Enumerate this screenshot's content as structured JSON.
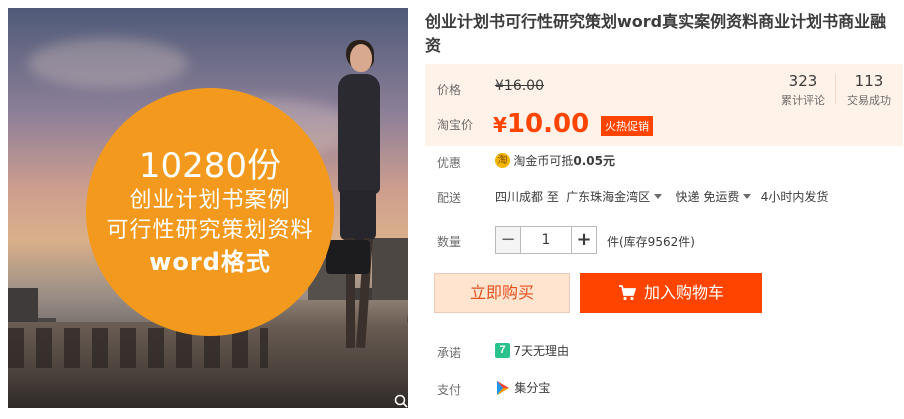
{
  "product": {
    "title": "创业计划书可行性研究策划word真实案例资料商业计划书商业融资",
    "image_banner": {
      "line1": "10280份",
      "line2": "创业计划书案例",
      "line3": "可行性研究策划资料",
      "line4": "word格式"
    }
  },
  "price": {
    "label": "价格",
    "original": "¥16.00",
    "taobao_label": "淘宝价",
    "currency_symbol": "¥",
    "current": "10.00",
    "promo_badge": "火热促销"
  },
  "stats": {
    "reviews_count": "323",
    "reviews_label": "累计评论",
    "sales_count": "113",
    "sales_label": "交易成功"
  },
  "discount": {
    "label": "优惠",
    "coin_glyph": "淘",
    "text": "淘金币可抵",
    "amount": "0.05元"
  },
  "delivery": {
    "label": "配送",
    "from": "四川成都 至",
    "to": "广东珠海金湾区",
    "method": "快递 免运费",
    "ship_time": "4小时内发货"
  },
  "quantity": {
    "label": "数量",
    "minus": "−",
    "value": "1",
    "plus": "+",
    "stock": "件(库存9562件)"
  },
  "buttons": {
    "buy_now": "立即购买",
    "add_to_cart": "加入购物车"
  },
  "promise": {
    "label": "承诺",
    "badge": "7",
    "text": "7天无理由"
  },
  "payment": {
    "label": "支付",
    "text": "集分宝"
  },
  "colors": {
    "accent": "#ff4400",
    "price_bg": "#fff2e8",
    "promo_circle": "#f39a1e",
    "buy_now_bg": "#ffe4d0"
  },
  "icons": {
    "zoom": "magnifier-icon",
    "cart": "shopping-cart-icon",
    "coin": "taobao-coin-icon",
    "seven_day": "seven-day-return-icon",
    "jifenbao": "jifenbao-icon"
  }
}
